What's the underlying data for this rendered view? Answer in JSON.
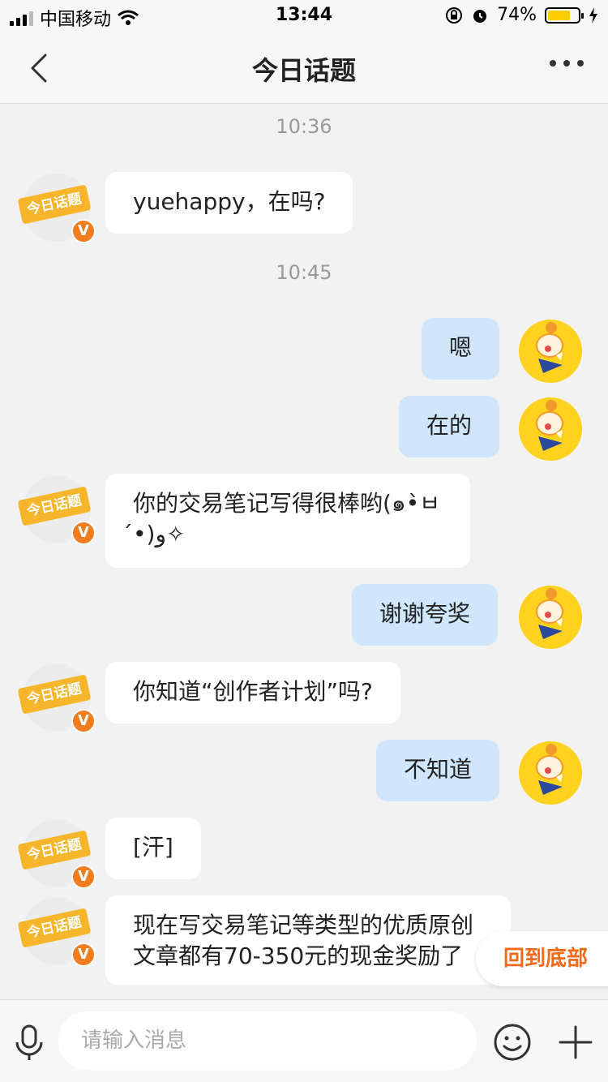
{
  "status_bar": {
    "carrier": "中国移动",
    "time": "13:44",
    "battery": "74%",
    "battery_level": 0.74
  },
  "header": {
    "title": "今日话题"
  },
  "bot_avatar": {
    "tag": "今日话题",
    "badge": "V"
  },
  "messages": {
    "t1": "10:36",
    "m1": "yuehappy，在吗?",
    "t2": "10:45",
    "m2": "嗯",
    "m3": "在的",
    "m4a": "你的交易笔记写得很棒哟(๑•̀ㅂ",
    "m4b": "•́)و✧",
    "m5": "谢谢夸奖",
    "m6": "你知道“创作者计划”吗?",
    "m7": "不知道",
    "m8": "[汗]",
    "m9a": "现在写交易笔记等类型的优质原创",
    "m9b": "文章都有70-350元的现金奖励了"
  },
  "scroll_to_bottom": "回到底部",
  "input": {
    "placeholder": "请输入消息"
  },
  "colors": {
    "accent": "#f06a1c",
    "outgoing_bubble": "#cfe6fb",
    "incoming_bubble": "#ffffff"
  }
}
